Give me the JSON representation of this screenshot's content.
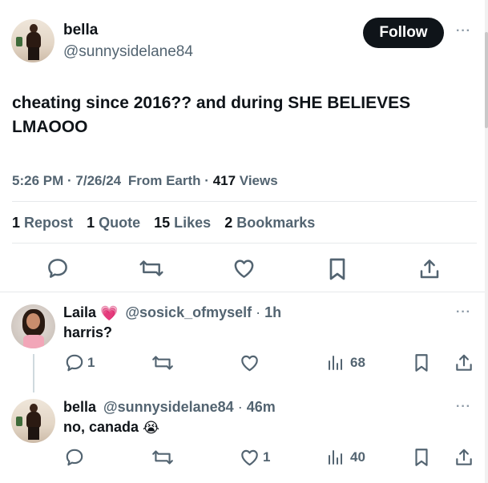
{
  "tweet": {
    "author_name": "bella",
    "author_handle": "@sunnysidelane84",
    "follow_label": "Follow",
    "more_label": "···",
    "text_line1": "cheating since 2016?? and during SHE BELIEVES",
    "text_line2": "LMAOOO",
    "time": "5:26 PM",
    "sep1": "·",
    "date": "7/26/24",
    "source": "From Earth",
    "sep2": "·",
    "views_count": "417",
    "views_label": "Views",
    "stats": [
      {
        "n": "1",
        "label": "Repost"
      },
      {
        "n": "1",
        "label": "Quote"
      },
      {
        "n": "15",
        "label": "Likes"
      },
      {
        "n": "2",
        "label": "Bookmarks"
      }
    ],
    "actions": [
      "reply-icon",
      "repost-icon",
      "like-icon",
      "bookmark-icon",
      "share-icon"
    ]
  },
  "replies": [
    {
      "name": "Laila",
      "name_emoji": "💗",
      "handle": "@sosick_ofmyself",
      "sep": "·",
      "time": "1h",
      "more_label": "···",
      "text": "harris?",
      "reply_count": "1",
      "repost_count": "",
      "like_count": "",
      "views_count": "68"
    },
    {
      "name": "bella",
      "handle": "@sunnysidelane84",
      "sep": "·",
      "time": "46m",
      "more_label": "···",
      "text": "no, canada",
      "text_emoji": "😭",
      "reply_count": "",
      "repost_count": "",
      "like_count": "1",
      "views_count": "40"
    }
  ],
  "colors": {
    "text_primary": "#0f1419",
    "text_secondary": "#536471",
    "follow_bg": "#0f1419",
    "heart_emoji": "#e83e8c"
  }
}
